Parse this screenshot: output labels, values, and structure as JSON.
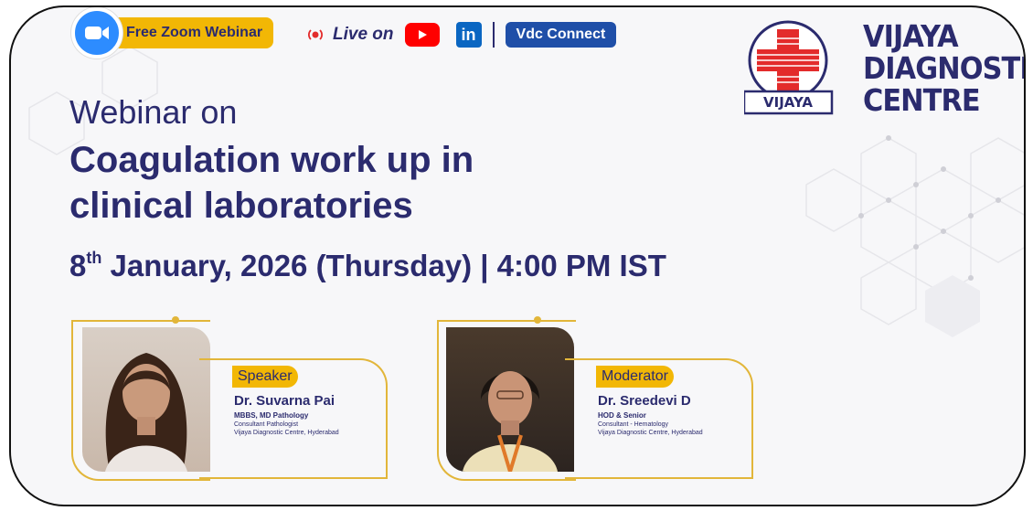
{
  "header": {
    "zoom_label": "Free Zoom Webinar",
    "live_label": "Live on",
    "channel_label": "Vdc Connect"
  },
  "logo": {
    "badge_text": "VIJAYA",
    "line1": "VIJAYA",
    "line2": "DIAGNOSTIC",
    "line3": "CENTRE",
    "registered": "®"
  },
  "headline": {
    "prefix": "Webinar on",
    "title_line1": "Coagulation work up in",
    "title_line2": "clinical laboratories"
  },
  "schedule": {
    "day": "8",
    "day_suffix": "th",
    "rest": " January, 2026 (Thursday) | 4:00 PM IST"
  },
  "speakers": [
    {
      "role": "Speaker",
      "name": "Dr. Suvarna Pai",
      "degree": "MBBS, MD Pathology",
      "title": "Consultant Pathologist",
      "org": "Vijaya Diagnostic Centre, Hyderabad"
    },
    {
      "role": "Moderator",
      "name": "Dr. Sreedevi D",
      "degree": "HOD & Senior",
      "title": "Consultant - Hematology",
      "org": "Vijaya Diagnostic Centre, Hyderabad"
    }
  ],
  "colors": {
    "navy": "#2b2b6e",
    "gold": "#f2b705",
    "zoom_blue": "#2d8cff",
    "youtube_red": "#ff0000",
    "linkedin_blue": "#0a66c2",
    "logo_red": "#e32b2b"
  },
  "icons": [
    "zoom-icon",
    "live-broadcast-icon",
    "youtube-icon",
    "linkedin-icon"
  ]
}
